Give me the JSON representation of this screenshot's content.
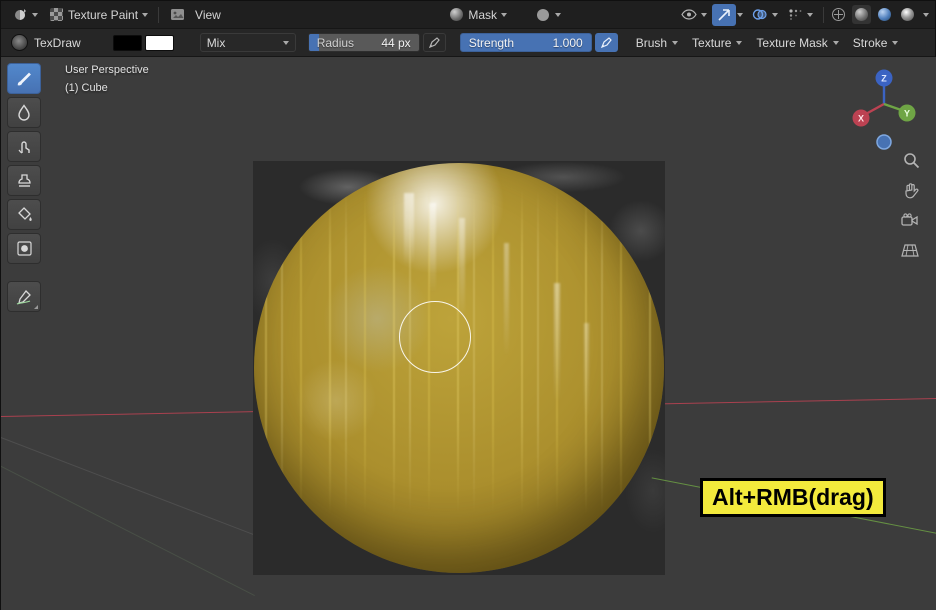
{
  "colors": {
    "accent": "#4772b3",
    "hint_bg": "#f3ea3c",
    "axis_x": "#bc4252",
    "axis_y": "#6fa545",
    "axis_z": "#3b63c3"
  },
  "header": {
    "mode_label": "Texture Paint",
    "view_label": "View",
    "mask_label": "Mask"
  },
  "tool_settings": {
    "brush_name": "TexDraw",
    "blend_label": "Mix",
    "radius_label": "Radius",
    "radius_value": "44 px",
    "strength_label": "Strength",
    "strength_value": "1.000",
    "brush_label": "Brush",
    "texture_label": "Texture",
    "texture_mask_label": "Texture Mask",
    "stroke_label": "Stroke"
  },
  "toolbar": {
    "tools": [
      "Draw",
      "Soften",
      "Smear",
      "Clone",
      "Fill",
      "Mask",
      "Annotate"
    ]
  },
  "viewport": {
    "perspective_label": "User Perspective",
    "object_label": "(1) Cube",
    "hint_label": "Alt+RMB(drag)"
  },
  "gizmo": {
    "x_label": "X",
    "y_label": "Y",
    "z_label": "Z"
  }
}
